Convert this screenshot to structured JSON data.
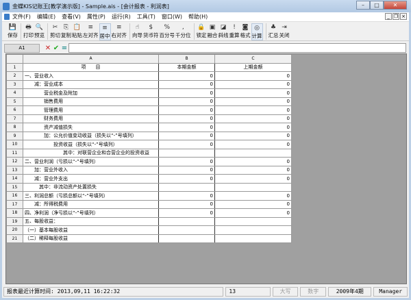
{
  "window": {
    "title": "金蝶KIS记账王[教学演示版] - Sample.ais - [会计报表 - 利润表]",
    "minimize": "–",
    "maximize": "□",
    "close": "✕"
  },
  "menu": [
    "文件(F)",
    "编辑(E)",
    "查看(V)",
    "属性(P)",
    "运行(R)",
    "工具(T)",
    "窗口(W)",
    "帮助(H)"
  ],
  "mdi": {
    "minimize": "_",
    "restore": "❐",
    "close": "×"
  },
  "toolbar": [
    {
      "label": "保存",
      "icon": "save-icon",
      "glyph": "💾"
    },
    {
      "sep": true
    },
    {
      "label": "打印",
      "icon": "print-icon",
      "glyph": "🖶"
    },
    {
      "label": "预览",
      "icon": "preview-icon",
      "glyph": "🔍"
    },
    {
      "sep": true
    },
    {
      "label": "剪切",
      "icon": "cut-icon",
      "glyph": "✂"
    },
    {
      "label": "复制",
      "icon": "copy-icon",
      "glyph": "⎘"
    },
    {
      "label": "粘贴",
      "icon": "paste-icon",
      "glyph": "📋"
    },
    {
      "label": "左对齐",
      "icon": "align-left-icon",
      "glyph": "≡"
    },
    {
      "label": "居中",
      "icon": "align-center-icon",
      "glyph": "≡",
      "active": true
    },
    {
      "label": "右对齐",
      "icon": "align-right-icon",
      "glyph": "≡"
    },
    {
      "sep": true
    },
    {
      "label": "向导",
      "icon": "wizard-icon",
      "glyph": "☝"
    },
    {
      "label": "货币符",
      "icon": "currency-icon",
      "glyph": "$"
    },
    {
      "label": "百分号",
      "icon": "percent-icon",
      "glyph": "%"
    },
    {
      "label": "千分位",
      "icon": "thousands-icon",
      "glyph": ","
    },
    {
      "sep": true
    },
    {
      "label": "锁定",
      "icon": "lock-icon",
      "glyph": "🔒"
    },
    {
      "label": "融合",
      "icon": "merge-icon",
      "glyph": "▣"
    },
    {
      "label": "斜线",
      "icon": "diagonal-icon",
      "glyph": "◪"
    },
    {
      "label": "重算",
      "icon": "recalc-icon",
      "glyph": "!"
    },
    {
      "label": "格式",
      "icon": "format-icon",
      "glyph": "◙"
    },
    {
      "label": "计算",
      "icon": "calculate-icon",
      "glyph": "◎",
      "active": true
    },
    {
      "sep": true
    },
    {
      "label": "汇总",
      "icon": "summary-icon",
      "glyph": "♣"
    },
    {
      "label": "关闭",
      "icon": "close-door-icon",
      "glyph": "⇥"
    }
  ],
  "formula": {
    "cell": "A1",
    "cancel": "✕",
    "confirm": "✔",
    "equals": "=",
    "value": ""
  },
  "grid": {
    "columns": [
      "A",
      "B",
      "C"
    ],
    "rows": [
      {
        "n": "1",
        "a": "项　　目",
        "b": "本期金额",
        "c": "上期金额",
        "header": true
      },
      {
        "n": "2",
        "a": "一、营业收入",
        "b": "0",
        "c": "0",
        "indent": 0
      },
      {
        "n": "3",
        "a": "减：营业成本",
        "b": "0",
        "c": "0",
        "indent": 1
      },
      {
        "n": "4",
        "a": "营业税金及附加",
        "b": "0",
        "c": "0",
        "indent": 2
      },
      {
        "n": "5",
        "a": "销售费用",
        "b": "0",
        "c": "0",
        "indent": 2
      },
      {
        "n": "6",
        "a": "管理费用",
        "b": "0",
        "c": "0",
        "indent": 2
      },
      {
        "n": "7",
        "a": "财务费用",
        "b": "0",
        "c": "0",
        "indent": 2
      },
      {
        "n": "8",
        "a": "资产减值损失",
        "b": "0",
        "c": "0",
        "indent": 2
      },
      {
        "n": "9",
        "a": "加：公允价值变动收益（损失以“-”号填列）",
        "b": "0",
        "c": "0",
        "indent": 2
      },
      {
        "n": "10",
        "a": "投资收益（损失以“-”号填列）",
        "b": "0",
        "c": "0",
        "indent": 3
      },
      {
        "n": "11",
        "a": "其中：对联营企业和合营企业的投资收益",
        "b": "",
        "c": "",
        "indent": 4
      },
      {
        "n": "12",
        "a": "二、营业利润（亏损以“-”号填列）",
        "b": "0",
        "c": "0",
        "indent": 0
      },
      {
        "n": "13",
        "a": "加：营业外收入",
        "b": "0",
        "c": "0",
        "indent": 1
      },
      {
        "n": "14",
        "a": "减：营业外支出",
        "b": "0",
        "c": "0",
        "indent": 1
      },
      {
        "n": "15",
        "a": "其中：非流动资产处置损失",
        "b": "",
        "c": "",
        "indent": 1.5
      },
      {
        "n": "16",
        "a": "三、利润总额（亏损总额以“-”号填列）",
        "b": "0",
        "c": "0",
        "indent": 0
      },
      {
        "n": "17",
        "a": "减：所得税费用",
        "b": "0",
        "c": "0",
        "indent": 1
      },
      {
        "n": "18",
        "a": "四、净利润（净亏损以“-”号填列）",
        "b": "0",
        "c": "0",
        "indent": 0
      },
      {
        "n": "19",
        "a": "五、每股收益：",
        "b": "",
        "c": "",
        "indent": 0
      },
      {
        "n": "20",
        "a": "（一）基本每股收益",
        "b": "",
        "c": "",
        "indent": 0
      },
      {
        "n": "21",
        "a": "（二）稀释每股收益",
        "b": "",
        "c": "",
        "indent": 0
      }
    ]
  },
  "status": {
    "calc_time": "报表最近计算时间: 2013,09,11 16:22:32",
    "count": "13",
    "caps": "大写",
    "num": "数字",
    "period": "2009年4期",
    "user": "Manager"
  }
}
